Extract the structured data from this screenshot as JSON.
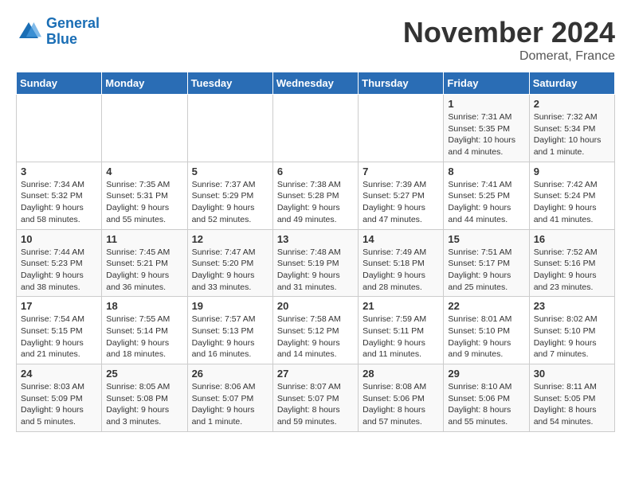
{
  "logo": {
    "text_general": "General",
    "text_blue": "Blue"
  },
  "header": {
    "month": "November 2024",
    "location": "Domerat, France"
  },
  "weekdays": [
    "Sunday",
    "Monday",
    "Tuesday",
    "Wednesday",
    "Thursday",
    "Friday",
    "Saturday"
  ],
  "weeks": [
    [
      {
        "day": "",
        "info": ""
      },
      {
        "day": "",
        "info": ""
      },
      {
        "day": "",
        "info": ""
      },
      {
        "day": "",
        "info": ""
      },
      {
        "day": "",
        "info": ""
      },
      {
        "day": "1",
        "info": "Sunrise: 7:31 AM\nSunset: 5:35 PM\nDaylight: 10 hours\nand 4 minutes."
      },
      {
        "day": "2",
        "info": "Sunrise: 7:32 AM\nSunset: 5:34 PM\nDaylight: 10 hours\nand 1 minute."
      }
    ],
    [
      {
        "day": "3",
        "info": "Sunrise: 7:34 AM\nSunset: 5:32 PM\nDaylight: 9 hours\nand 58 minutes."
      },
      {
        "day": "4",
        "info": "Sunrise: 7:35 AM\nSunset: 5:31 PM\nDaylight: 9 hours\nand 55 minutes."
      },
      {
        "day": "5",
        "info": "Sunrise: 7:37 AM\nSunset: 5:29 PM\nDaylight: 9 hours\nand 52 minutes."
      },
      {
        "day": "6",
        "info": "Sunrise: 7:38 AM\nSunset: 5:28 PM\nDaylight: 9 hours\nand 49 minutes."
      },
      {
        "day": "7",
        "info": "Sunrise: 7:39 AM\nSunset: 5:27 PM\nDaylight: 9 hours\nand 47 minutes."
      },
      {
        "day": "8",
        "info": "Sunrise: 7:41 AM\nSunset: 5:25 PM\nDaylight: 9 hours\nand 44 minutes."
      },
      {
        "day": "9",
        "info": "Sunrise: 7:42 AM\nSunset: 5:24 PM\nDaylight: 9 hours\nand 41 minutes."
      }
    ],
    [
      {
        "day": "10",
        "info": "Sunrise: 7:44 AM\nSunset: 5:23 PM\nDaylight: 9 hours\nand 38 minutes."
      },
      {
        "day": "11",
        "info": "Sunrise: 7:45 AM\nSunset: 5:21 PM\nDaylight: 9 hours\nand 36 minutes."
      },
      {
        "day": "12",
        "info": "Sunrise: 7:47 AM\nSunset: 5:20 PM\nDaylight: 9 hours\nand 33 minutes."
      },
      {
        "day": "13",
        "info": "Sunrise: 7:48 AM\nSunset: 5:19 PM\nDaylight: 9 hours\nand 31 minutes."
      },
      {
        "day": "14",
        "info": "Sunrise: 7:49 AM\nSunset: 5:18 PM\nDaylight: 9 hours\nand 28 minutes."
      },
      {
        "day": "15",
        "info": "Sunrise: 7:51 AM\nSunset: 5:17 PM\nDaylight: 9 hours\nand 25 minutes."
      },
      {
        "day": "16",
        "info": "Sunrise: 7:52 AM\nSunset: 5:16 PM\nDaylight: 9 hours\nand 23 minutes."
      }
    ],
    [
      {
        "day": "17",
        "info": "Sunrise: 7:54 AM\nSunset: 5:15 PM\nDaylight: 9 hours\nand 21 minutes."
      },
      {
        "day": "18",
        "info": "Sunrise: 7:55 AM\nSunset: 5:14 PM\nDaylight: 9 hours\nand 18 minutes."
      },
      {
        "day": "19",
        "info": "Sunrise: 7:57 AM\nSunset: 5:13 PM\nDaylight: 9 hours\nand 16 minutes."
      },
      {
        "day": "20",
        "info": "Sunrise: 7:58 AM\nSunset: 5:12 PM\nDaylight: 9 hours\nand 14 minutes."
      },
      {
        "day": "21",
        "info": "Sunrise: 7:59 AM\nSunset: 5:11 PM\nDaylight: 9 hours\nand 11 minutes."
      },
      {
        "day": "22",
        "info": "Sunrise: 8:01 AM\nSunset: 5:10 PM\nDaylight: 9 hours\nand 9 minutes."
      },
      {
        "day": "23",
        "info": "Sunrise: 8:02 AM\nSunset: 5:10 PM\nDaylight: 9 hours\nand 7 minutes."
      }
    ],
    [
      {
        "day": "24",
        "info": "Sunrise: 8:03 AM\nSunset: 5:09 PM\nDaylight: 9 hours\nand 5 minutes."
      },
      {
        "day": "25",
        "info": "Sunrise: 8:05 AM\nSunset: 5:08 PM\nDaylight: 9 hours\nand 3 minutes."
      },
      {
        "day": "26",
        "info": "Sunrise: 8:06 AM\nSunset: 5:07 PM\nDaylight: 9 hours\nand 1 minute."
      },
      {
        "day": "27",
        "info": "Sunrise: 8:07 AM\nSunset: 5:07 PM\nDaylight: 8 hours\nand 59 minutes."
      },
      {
        "day": "28",
        "info": "Sunrise: 8:08 AM\nSunset: 5:06 PM\nDaylight: 8 hours\nand 57 minutes."
      },
      {
        "day": "29",
        "info": "Sunrise: 8:10 AM\nSunset: 5:06 PM\nDaylight: 8 hours\nand 55 minutes."
      },
      {
        "day": "30",
        "info": "Sunrise: 8:11 AM\nSunset: 5:05 PM\nDaylight: 8 hours\nand 54 minutes."
      }
    ]
  ]
}
